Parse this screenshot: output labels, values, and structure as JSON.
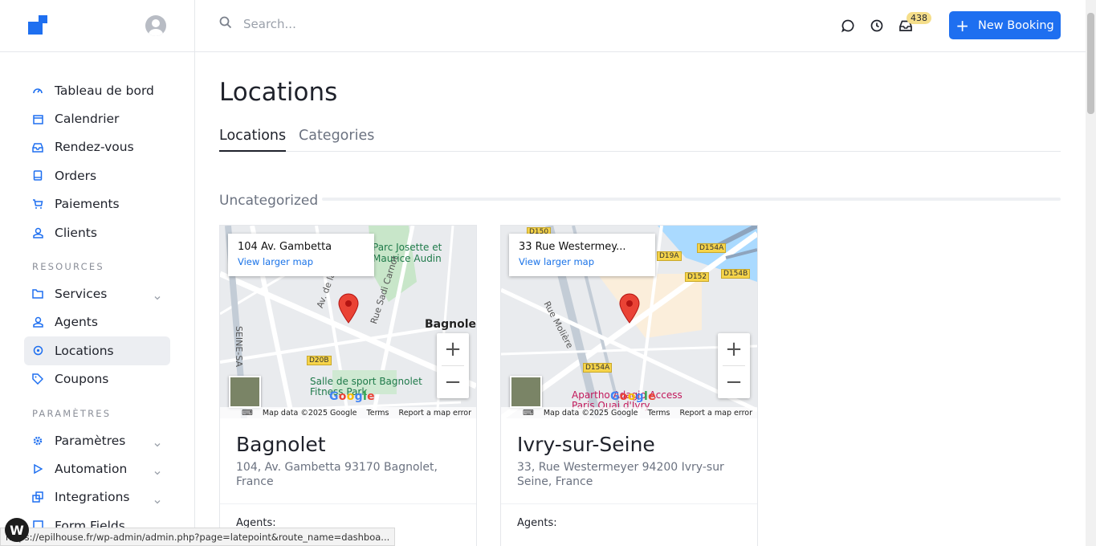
{
  "sidebar": {
    "items": [
      {
        "label": "Tableau de bord",
        "icon": "dashboard-icon"
      },
      {
        "label": "Calendrier",
        "icon": "calendar-icon"
      },
      {
        "label": "Rendez-vous",
        "icon": "inbox-icon"
      },
      {
        "label": "Orders",
        "icon": "book-icon"
      },
      {
        "label": "Paiements",
        "icon": "cart-icon"
      },
      {
        "label": "Clients",
        "icon": "user-icon"
      }
    ],
    "resources_label": "RESOURCES",
    "resources": [
      {
        "label": "Services",
        "icon": "folder-icon",
        "has_children": true
      },
      {
        "label": "Agents",
        "icon": "user-icon",
        "has_children": false
      },
      {
        "label": "Locations",
        "icon": "location-pin-icon",
        "has_children": false,
        "active": true
      },
      {
        "label": "Coupons",
        "icon": "tag-icon",
        "has_children": false
      }
    ],
    "settings_label": "PARAMÈTRES",
    "settings": [
      {
        "label": "Paramètres",
        "icon": "gear-icon",
        "has_children": true
      },
      {
        "label": "Automation",
        "icon": "play-icon",
        "has_children": true
      },
      {
        "label": "Integrations",
        "icon": "integrations-icon",
        "has_children": true
      },
      {
        "label": "Form Fields",
        "icon": "form-icon",
        "has_children": false
      }
    ]
  },
  "topbar": {
    "search_placeholder": "Search...",
    "notification_count": "438",
    "new_booking_label": "New Booking"
  },
  "main": {
    "title": "Locations",
    "tabs": [
      {
        "label": "Locations",
        "active": true
      },
      {
        "label": "Categories",
        "active": false
      }
    ],
    "group_title": "Uncategorized",
    "locations": [
      {
        "map_address": "104 Av. Gambetta",
        "map_link": "View larger map",
        "name": "Bagnolet",
        "address": "104, Av. Gambetta 93170 Bagnolet, France",
        "agents_label": "Agents:",
        "map_labels": {
          "park": "Parc Josette et Maurice Audin",
          "city": "Bagnolet",
          "street1": "Rue Sadi Carnot",
          "street2": "Av. de la",
          "gym": "Salle de sport Bagnolet Fitness Park",
          "road": "D20B",
          "side": "SEINE-SA"
        }
      },
      {
        "map_address": "33 Rue Westermey...",
        "map_link": "View larger map",
        "name": "Ivry-sur-Seine",
        "address": "33, Rue Westermeyer 94200 Ivry-sur Seine, France",
        "agents_label": "Agents:",
        "map_labels": {
          "street1": "Rue Molière",
          "hotel": "Apartho Adagio Access Paris Quai d'Ivry",
          "r1": "D150",
          "r2": "D19A",
          "r3": "D154A",
          "r4": "D152",
          "r5": "D154B",
          "r6": "D154A"
        }
      }
    ],
    "map_attrib": {
      "data": "Map data ©2025 Google",
      "terms": "Terms",
      "report": "Report a map error",
      "google": "Google"
    }
  },
  "status_url": "https://epilhouse.fr/wp-admin/admin.php?page=latepoint&route_name=dashboa..."
}
